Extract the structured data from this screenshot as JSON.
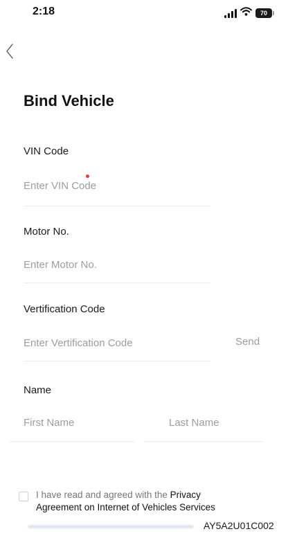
{
  "status_bar": {
    "time": "2:18",
    "battery": "70",
    "icons": [
      "signal-icon",
      "wifi-icon",
      "battery-icon"
    ]
  },
  "header": {
    "back_icon": "chevron-left-icon",
    "title": "Bind Vehicle"
  },
  "form": {
    "vin": {
      "label": "VIN Code",
      "placeholder": "Enter VIN Code",
      "value": ""
    },
    "motor": {
      "label": "Motor No.",
      "placeholder": "Enter Motor No.",
      "value": ""
    },
    "verification": {
      "label": "Vertification Code",
      "placeholder": "Enter Vertification Code",
      "value": "",
      "send_label": "Send"
    },
    "name": {
      "label": "Name",
      "first_placeholder": "First Name",
      "last_placeholder": "Last Name",
      "first_value": "",
      "last_value": ""
    }
  },
  "agreement": {
    "checked": false,
    "prefix": "I have read and agreed with the ",
    "link_part1": "Privacy",
    "link_part2": "Agreement on Internet of Vehicles Services"
  },
  "footer": {
    "code": "AY5A2U01C002"
  },
  "colors": {
    "placeholder": "#9d9d9d",
    "divider": "#ececec",
    "accent_dot": "#e23b3b"
  }
}
